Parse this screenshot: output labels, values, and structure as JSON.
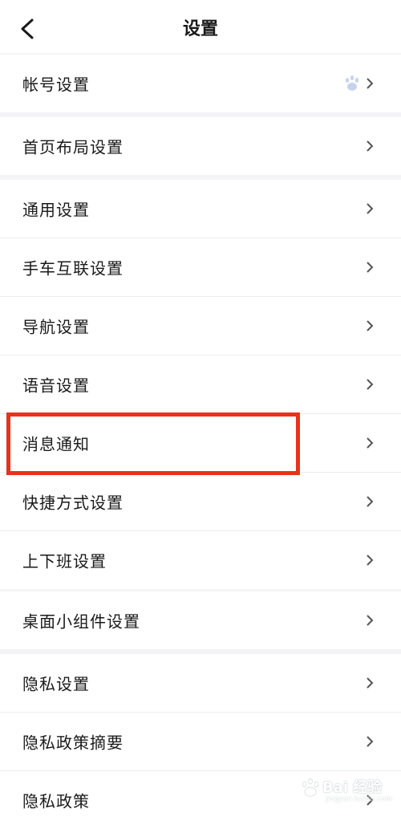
{
  "header": {
    "title": "设置"
  },
  "groups": [
    {
      "items": [
        {
          "label": "帐号设置",
          "has_paw": true
        }
      ]
    },
    {
      "items": [
        {
          "label": "首页布局设置"
        }
      ]
    },
    {
      "items": [
        {
          "label": "通用设置"
        },
        {
          "label": "手车互联设置"
        },
        {
          "label": "导航设置"
        },
        {
          "label": "语音设置"
        },
        {
          "label": "消息通知"
        },
        {
          "label": "快捷方式设置"
        },
        {
          "label": "上下班设置"
        }
      ]
    },
    {
      "items": [
        {
          "label": "桌面小组件设置"
        }
      ]
    },
    {
      "items": [
        {
          "label": "隐私设置"
        },
        {
          "label": "隐私政策摘要"
        },
        {
          "label": "隐私政策"
        }
      ]
    }
  ],
  "watermark": {
    "text": "Bai 经验",
    "sub": "jingyan.baidu.com"
  },
  "colors": {
    "highlight": "#e8321d",
    "background": "#f4f4f6",
    "row_bg": "#ffffff"
  }
}
